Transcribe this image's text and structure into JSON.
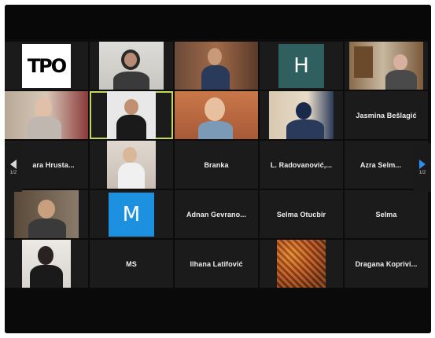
{
  "participants": {
    "r1c3_name": "",
    "r1c4_initial": "H",
    "r1c4_color": "#2f5f5f",
    "r1c1_logo": "TPO",
    "r2c5_name": "Jasmina Bešlagić",
    "r3c1_name": "ara Hrusta...",
    "r3c3_name": "Branka",
    "r3c4_name": "L. Radovanović,...",
    "r3c5_name": "Azra Selm...",
    "r4c2_initial": "M",
    "r4c2_color": "#1e90e0",
    "r4c3_name": "Adnan Gevrano...",
    "r4c4_name": "Selma Otucbir",
    "r4c5_name": "Selma",
    "r5c2_name": "MS",
    "r5c3_name": "Ilhana Latifović",
    "r5c5_name": "Dragana Koprivi..."
  },
  "navigation": {
    "left_page": "1/2",
    "right_page": "1/2"
  },
  "colors": {
    "active_speaker_border": "#c6d85a",
    "next_arrow": "#2f8ff0"
  }
}
